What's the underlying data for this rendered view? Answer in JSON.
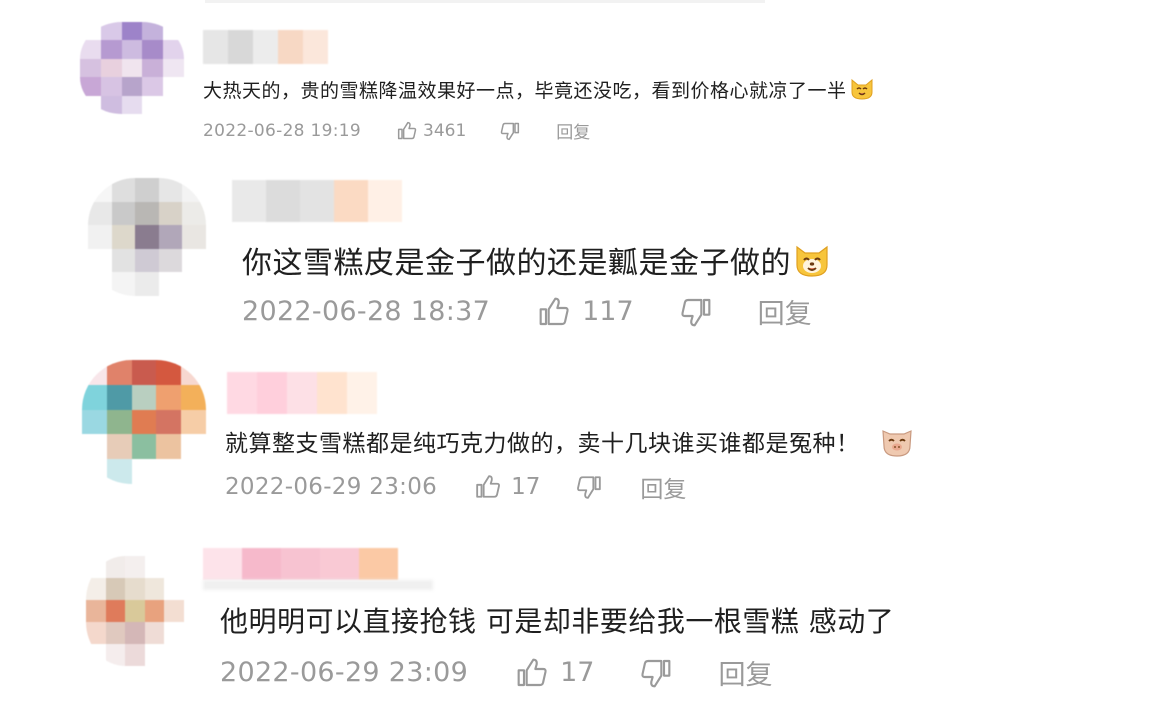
{
  "comments": [
    {
      "text": "大热天的，贵的雪糕降温效果好一点，毕竟还没吃，看到价格心就凉了一半",
      "emoji": "cat-face-emoji",
      "time": "2022-06-28 19:19",
      "likes": "3461",
      "reply": "回复"
    },
    {
      "text": "你这雪糕皮是金子做的还是瓤是金子做的",
      "emoji": "dog-face-emoji",
      "time": "2022-06-28 18:37",
      "likes": "117",
      "reply": "回复"
    },
    {
      "text": "就算整支雪糕都是纯巧克力做的，卖十几块谁买谁都是冤种！",
      "emoji": "pig-face-emoji",
      "time": "2022-06-29 23:06",
      "likes": "17",
      "reply": "回复"
    },
    {
      "text": "他明明可以直接抢钱 可是却非要给我一根雪糕 感动了",
      "emoji": "",
      "time": "2022-06-29 23:09",
      "likes": "17",
      "reply": "回复"
    }
  ],
  "colors": {
    "meta_gray": "#9a9a9a",
    "text": "#1f1f1f",
    "emoji_yellow": "#f7c53c"
  }
}
